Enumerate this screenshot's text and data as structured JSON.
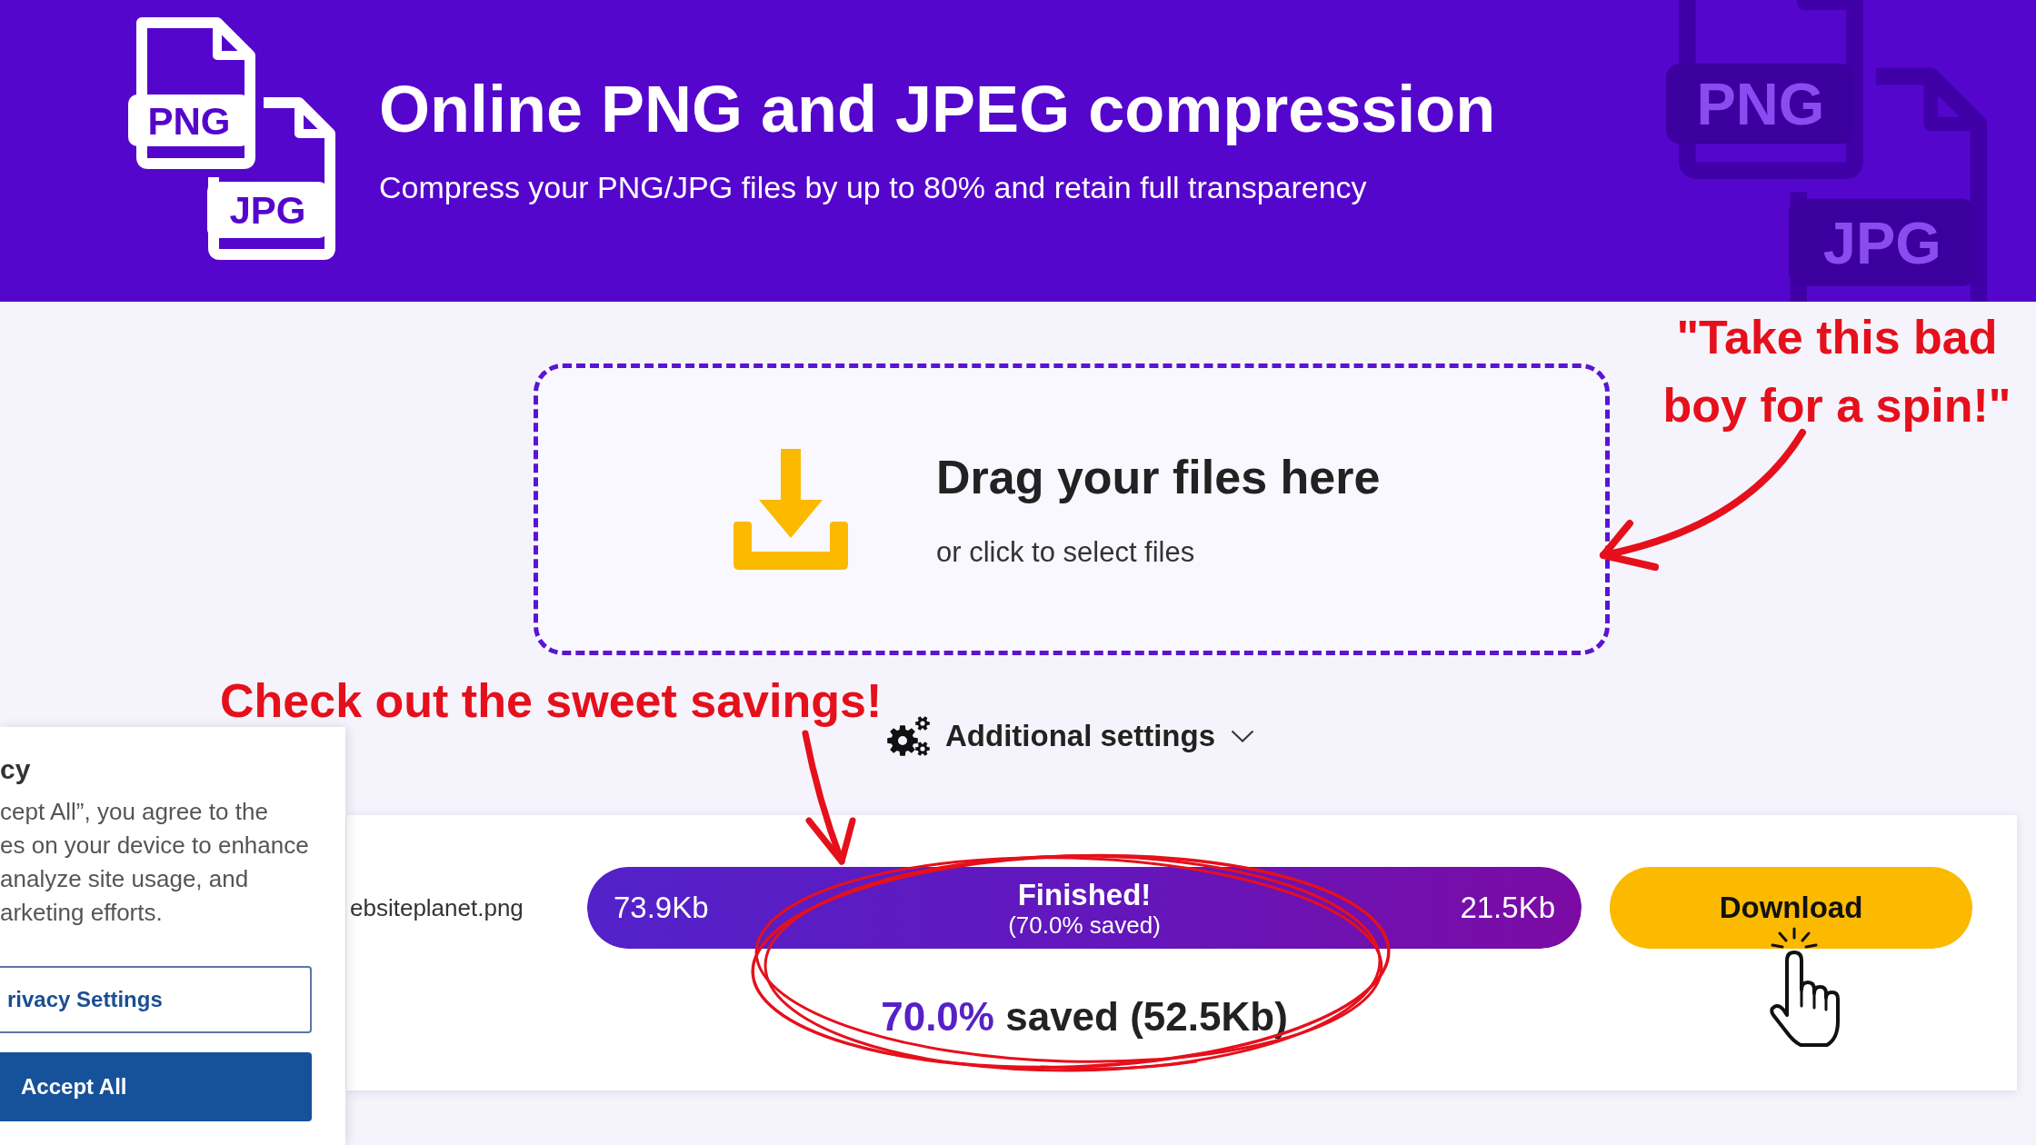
{
  "header": {
    "logo": {
      "labels": [
        "PNG",
        "JPG"
      ]
    },
    "title": "Online PNG and JPEG compression",
    "subtitle": "Compress your PNG/JPG files by up to 80% and retain full transparency",
    "background_logo": {
      "labels": [
        "PNG",
        "JPG"
      ]
    }
  },
  "dropzone": {
    "title": "Drag your files here",
    "hint": "or click to select files"
  },
  "settings_toggle": {
    "label": "Additional settings",
    "expanded": false
  },
  "result": {
    "filename": "ebsiteplanet.png",
    "progress": {
      "level": 1,
      "original_size": "73.9Kb",
      "status": "Finished!",
      "detail": "(70.0% saved)",
      "compressed_size": "21.5Kb"
    },
    "saved_percent": "70.0%",
    "saved_text": "saved (52.5Kb)",
    "download_button": "Download"
  },
  "cookie_banner": {
    "heading": "cy",
    "text_lines": [
      "cept All”, you agree to the",
      "es on your device to enhance",
      "analyze site usage, and",
      "arketing efforts."
    ],
    "buttons": [
      {
        "label": "rivacy Settings",
        "kind": "outline"
      },
      {
        "label": "Accept All",
        "kind": "filled"
      }
    ]
  },
  "annotations": {
    "spin_note": "\"Take this bad boy for a spin!\"",
    "savings_note": "Check out the sweet savings!"
  }
}
